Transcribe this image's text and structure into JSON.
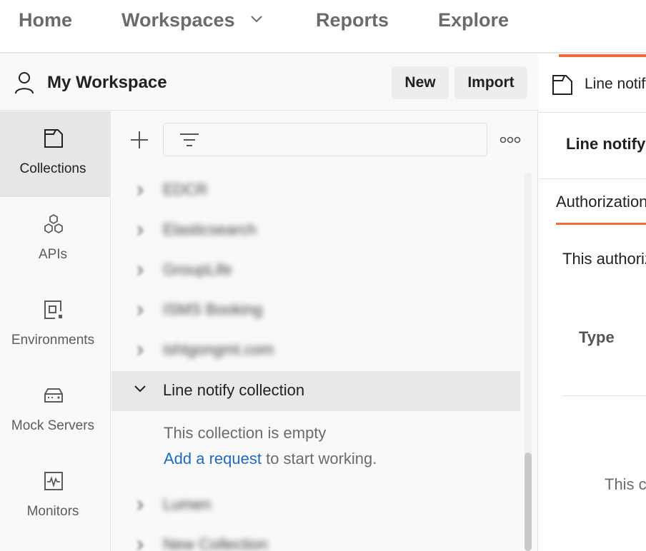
{
  "topnav": {
    "items": [
      {
        "label": "Home"
      },
      {
        "label": "Workspaces"
      },
      {
        "label": "Reports"
      },
      {
        "label": "Explore"
      }
    ]
  },
  "workspace": {
    "title": "My Workspace",
    "new_label": "New",
    "import_label": "Import"
  },
  "rail": {
    "items": [
      {
        "label": "Collections",
        "icon": "collections-icon",
        "active": true
      },
      {
        "label": "APIs",
        "icon": "apis-icon"
      },
      {
        "label": "Environments",
        "icon": "environments-icon"
      },
      {
        "label": "Mock Servers",
        "icon": "mock-servers-icon"
      },
      {
        "label": "Monitors",
        "icon": "monitors-icon"
      }
    ]
  },
  "collections": {
    "blurred_rows": [
      {
        "label": "EDCR"
      },
      {
        "label": "Elasticsearch"
      },
      {
        "label": "GroupLife"
      },
      {
        "label": "ISMS Booking"
      },
      {
        "label": "ishtgongmt.com"
      }
    ],
    "open_row": {
      "label": "Line notify collection"
    },
    "empty_text": "This collection is empty",
    "add_request_link": "Add a request",
    "add_request_suffix": " to start working.",
    "more_rows": [
      {
        "label": "Lumen"
      },
      {
        "label": "New Collection"
      }
    ]
  },
  "request": {
    "tab_label": "Line notify collection",
    "title": "Line notify collection",
    "auth_tab": "Authorization",
    "auth_desc": "This authorization method will be used",
    "type_label": "Type",
    "bottom_text": "This collection does not use any auth"
  },
  "colors": {
    "accent": "#f26b3a",
    "link": "#1a6bc4"
  }
}
